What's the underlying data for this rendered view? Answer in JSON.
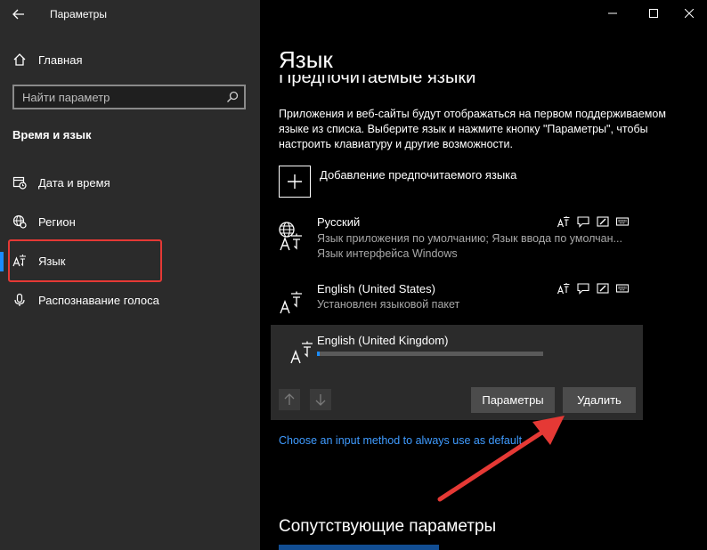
{
  "window": {
    "title": "Параметры"
  },
  "sidebar": {
    "home_label": "Главная",
    "search_placeholder": "Найти параметр",
    "section_title": "Время и язык",
    "items": [
      {
        "label": "Дата и время",
        "icon": "calendar-clock-icon"
      },
      {
        "label": "Регион",
        "icon": "globe-gear-icon"
      },
      {
        "label": "Язык",
        "icon": "language-icon",
        "active": true
      },
      {
        "label": "Распознавание голоса",
        "icon": "microphone-icon"
      }
    ]
  },
  "main": {
    "title": "Язык",
    "subtitle": "Предпочитаемые языки",
    "description": "Приложения и веб-сайты будут отображаться на первом поддерживаемом языке из списка. Выберите язык и нажмите кнопку \"Параметры\", чтобы настроить клавиатуру и другие возможности.",
    "add_language_label": "Добавление предпочитаемого языка",
    "languages": [
      {
        "name": "Русский",
        "line1": "Язык приложения по умолчанию; Язык ввода по умолчан...",
        "line2": "Язык интерфейса Windows"
      },
      {
        "name": "English (United States)",
        "line1": "Установлен языковой пакет"
      },
      {
        "name": "English (United Kingdom)",
        "download_progress": 0.01
      }
    ],
    "options_button": "Параметры",
    "remove_button": "Удалить",
    "input_method_link": "Choose an input method to always use as default",
    "related_title": "Сопутствующие параметры"
  },
  "colors": {
    "accent": "#1a8cff",
    "sidebar_bg": "#2b2b2b",
    "main_bg": "#000000",
    "annotation_red": "#e53935"
  }
}
